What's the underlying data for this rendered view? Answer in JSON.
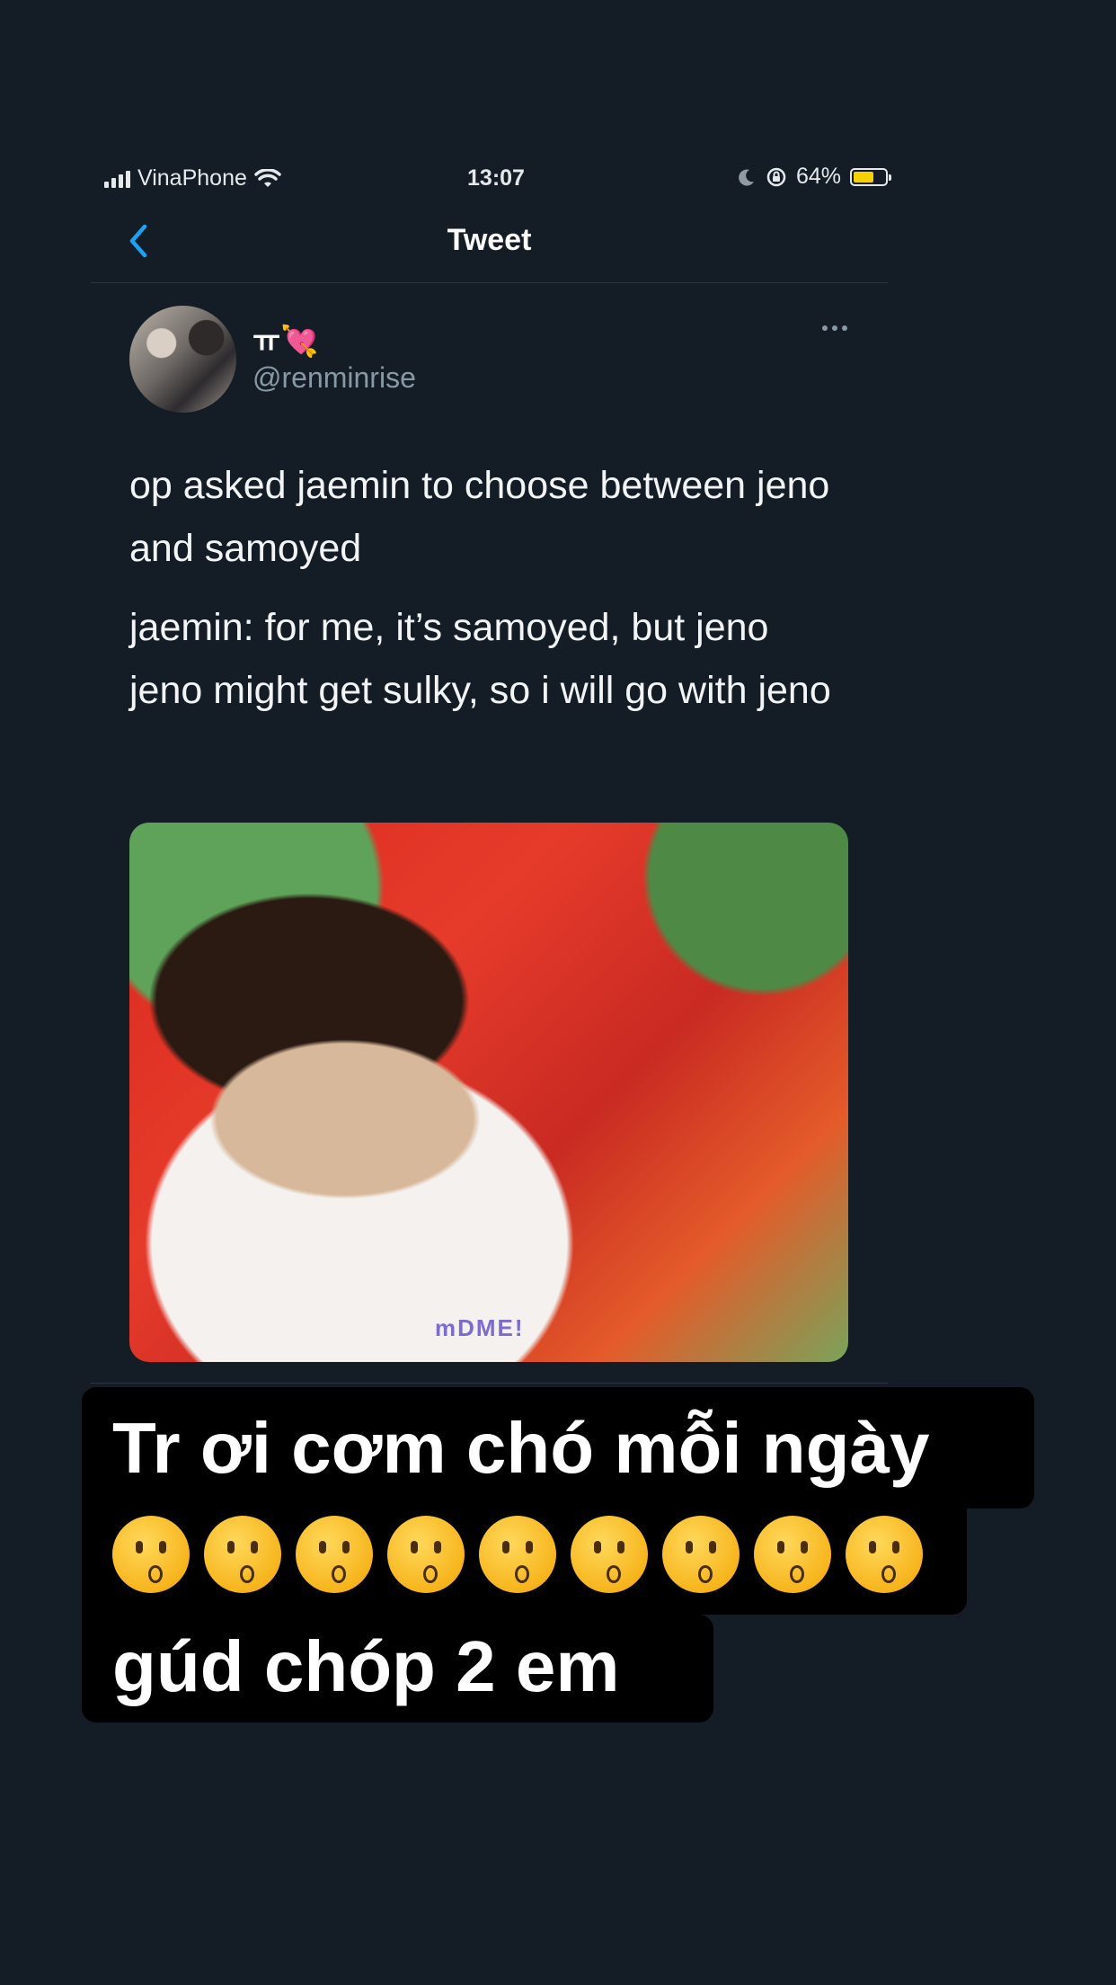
{
  "status_bar": {
    "carrier": "VinaPhone",
    "time": "13:07",
    "battery_percent_text": "64%",
    "battery_level": 0.64,
    "battery_color": "#f5d100"
  },
  "nav": {
    "back_icon": "chevron-left-icon",
    "title": "Tweet",
    "accent_color": "#1da1f2"
  },
  "tweet": {
    "display_name": "ㅠ💘",
    "handle": "@renminrise",
    "paragraphs": [
      "op asked jaemin to choose between jeno and samoyed",
      "jaemin: for me, it’s samoyed, but jeno jeno might get sulky, so i will go with jeno"
    ],
    "media_stamp": "mDME!"
  },
  "caption": {
    "line1": "Tr ơi cơm chó mỗi ngày",
    "emoji_count": 9,
    "line3": "gúd chóp 2 em"
  },
  "colors": {
    "background": "#141d26",
    "secondary_text": "#8899a6",
    "divider": "#2c3640"
  }
}
